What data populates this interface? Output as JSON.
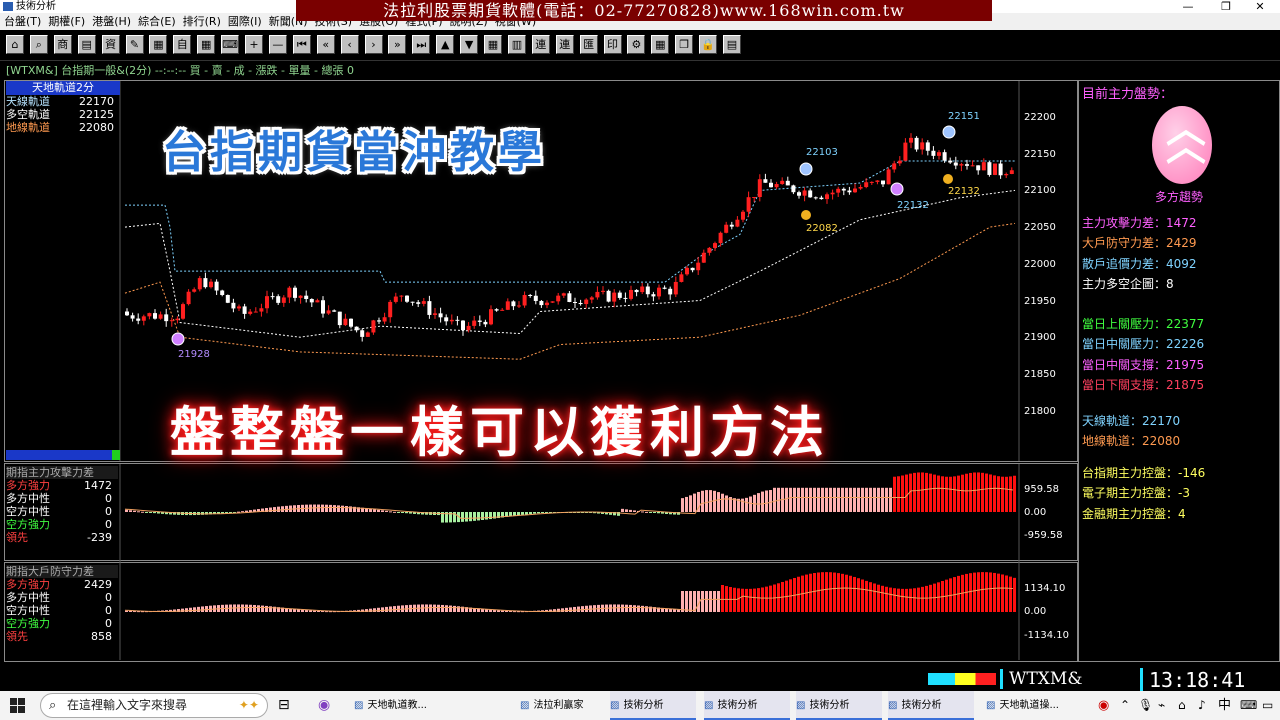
{
  "window": {
    "title": "技術分析"
  },
  "menu": [
    "台盤(T)",
    "期權(F)",
    "港盤(H)",
    "綜合(E)",
    "排行(R)",
    "國際(I)",
    "新聞(N)",
    "技術(S)",
    "選股(O)",
    "程式(P)",
    "說明(Z)",
    "視窗(W)"
  ],
  "banner": "法拉利股票期貨軟體(電話：02-77270828)www.168win.com.tw",
  "toolbar_icons": [
    "home-icon",
    "search-icon",
    "product-icon",
    "chart-icon",
    "data-icon",
    "note-icon",
    "news-icon",
    "auto-icon",
    "calc-icon",
    "keyboard-icon",
    "plus-icon",
    "minus-icon",
    "first-icon",
    "rewind-icon",
    "prev-icon",
    "next-icon",
    "forward-icon",
    "last-icon",
    "up-icon",
    "down-icon",
    "grid-icon",
    "bars-icon",
    "connect-icon",
    "link-icon",
    "export-icon",
    "print-icon",
    "settings-icon",
    "layout-icon",
    "window-icon",
    "lock-icon",
    "table-icon"
  ],
  "toolbar_labels": {
    "product": "商",
    "data": "資",
    "auto": "自",
    "plus": "+",
    "minus": "—",
    "connect": "連",
    "link": "連",
    "export": "匯",
    "print": "印"
  },
  "infobar": "[WTXM&]  台指期一般&(2分)   --:--:--  買 -  賣 -  成 -  漲跌 -  單量 -  總張 0",
  "main_legend": {
    "header": "天地軌道2分",
    "rows": [
      {
        "label": "天線軌道",
        "value": "22170",
        "color": "#b6e3ff"
      },
      {
        "label": "多空軌道",
        "value": "22125",
        "color": "#ffffff"
      },
      {
        "label": "地線軌道",
        "value": "22080",
        "color": "#ff9a50"
      }
    ]
  },
  "price_axis": [
    "22200",
    "22150",
    "22100",
    "22050",
    "22000",
    "21950",
    "21900",
    "21850",
    "21800"
  ],
  "annotations": [
    {
      "text": "22151",
      "color": "#7fd3ff"
    },
    {
      "text": "22103",
      "color": "#7fd3ff"
    },
    {
      "text": "22132",
      "color": "#7fd3ff"
    },
    {
      "text": "22132",
      "color": "#ffd84a"
    },
    {
      "text": "22082",
      "color": "#ffd84a"
    },
    {
      "text": "21928",
      "color": "#b48cff"
    }
  ],
  "overlay": {
    "title": "台指期貨當沖教學",
    "subtitle": "盤整盤一樣可以獲利方法"
  },
  "sub1": {
    "title": "期指主力攻擊力差",
    "rows": [
      {
        "label": "多方強力",
        "value": "1472",
        "color": "#ff4040"
      },
      {
        "label": "多方中性",
        "value": "0",
        "color": "#ffffff"
      },
      {
        "label": "空方中性",
        "value": "0",
        "color": "#ffffff"
      },
      {
        "label": "空方強力",
        "value": "0",
        "color": "#40ff40"
      },
      {
        "label": "領先",
        "value": "-239",
        "color": "#ff4040"
      }
    ],
    "axis": [
      "959.58",
      "0.00",
      "-959.58"
    ]
  },
  "sub2": {
    "title": "期指大戶防守力差",
    "rows": [
      {
        "label": "多方強力",
        "value": "2429",
        "color": "#ff4040"
      },
      {
        "label": "多方中性",
        "value": "0",
        "color": "#ffffff"
      },
      {
        "label": "空方中性",
        "value": "0",
        "color": "#ffffff"
      },
      {
        "label": "空方強力",
        "value": "0",
        "color": "#40ff40"
      },
      {
        "label": "領先",
        "value": "858",
        "color": "#ff4040"
      }
    ],
    "axis": [
      "1134.10",
      "0.00",
      "-1134.10"
    ]
  },
  "right_panel": {
    "heading": "目前主力盤勢：",
    "trend": "多方趨勢",
    "g1": [
      {
        "t": "主力攻擊力差：1472",
        "c": "#ff60ff"
      },
      {
        "t": "大戶防守力差：2429",
        "c": "#ff9a50"
      },
      {
        "t": "散戶追價力差：4092",
        "c": "#7fd3ff"
      },
      {
        "t": "主力多空企圖：8",
        "c": "#ffffff"
      }
    ],
    "g2": [
      {
        "t": "當日上關壓力：22377",
        "c": "#40ff40"
      },
      {
        "t": "當日中關壓力：22226",
        "c": "#7fd3ff"
      },
      {
        "t": "當日中關支撐：21975",
        "c": "#ff60ff"
      },
      {
        "t": "當日下關支撐：21875",
        "c": "#ff4060"
      }
    ],
    "g3": [
      {
        "t": "天線軌道：22170",
        "c": "#7fd3ff"
      },
      {
        "t": "地線軌道：22080",
        "c": "#ff9a50"
      }
    ],
    "g4": [
      {
        "t": "台指期主力控盤：-146",
        "c": "#ffff60"
      },
      {
        "t": "電子期主力控盤：-3",
        "c": "#ffff60"
      },
      {
        "t": "金融期主力控盤：4",
        "c": "#ffff60"
      }
    ]
  },
  "status": {
    "symbol": "WTXM&",
    "time": "13:18:41"
  },
  "taskbar": {
    "search_placeholder": "在這裡輸入文字來搜尋",
    "apps": [
      "天地軌道教...",
      "法拉利贏家",
      "技術分析",
      "技術分析",
      "技術分析",
      "技術分析",
      "天地軌道操..."
    ],
    "tray": "中"
  }
}
